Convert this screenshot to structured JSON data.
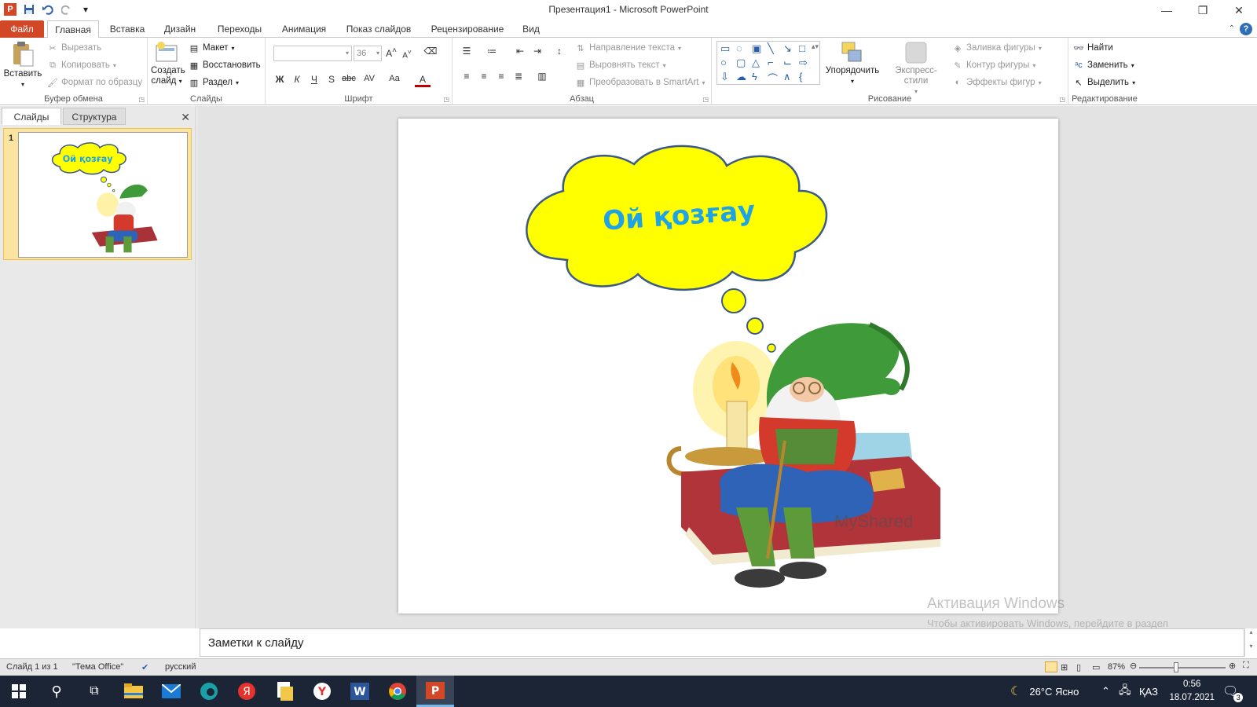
{
  "window": {
    "title": "Презентация1 - Microsoft PowerPoint"
  },
  "tabs": [
    "Файл",
    "Главная",
    "Вставка",
    "Дизайн",
    "Переходы",
    "Анимация",
    "Показ слайдов",
    "Рецензирование",
    "Вид"
  ],
  "ribbon": {
    "clipboard": {
      "label": "Буфер обмена",
      "paste": "Вставить",
      "cut": "Вырезать",
      "copy": "Копировать",
      "format_painter": "Формат по образцу"
    },
    "slides": {
      "label": "Слайды",
      "new_slide": "Создать слайд",
      "layout": "Макет",
      "reset": "Восстановить",
      "section": "Раздел"
    },
    "font": {
      "label": "Шрифт",
      "font_size": "36",
      "bold": "Ж",
      "italic": "К",
      "underline": "Ч",
      "shadow": "S",
      "strike": "abc",
      "spacing": "AV",
      "case": "Aa",
      "color": "A",
      "grow": "A",
      "shrink": "A"
    },
    "paragraph": {
      "label": "Абзац",
      "text_direction": "Направление текста",
      "align_text": "Выровнять текст",
      "smartart": "Преобразовать в SmartArt"
    },
    "drawing": {
      "label": "Рисование",
      "arrange": "Упорядочить",
      "quick_styles": "Экспресс-стили",
      "shape_fill": "Заливка фигуры",
      "shape_outline": "Контур фигуры",
      "shape_effects": "Эффекты фигур"
    },
    "editing": {
      "label": "Редактирование",
      "find": "Найти",
      "replace": "Заменить",
      "select": "Выделить"
    }
  },
  "left_panel": {
    "tabs": [
      "Слайды",
      "Структура"
    ],
    "slide_number": "1",
    "thumb_text": "Ой қозғау"
  },
  "slide": {
    "bubble_text": "Ой қозғау",
    "image_watermark": "MyShared"
  },
  "notes": {
    "placeholder": "Заметки к слайду"
  },
  "activation": {
    "title": "Активация Windows",
    "text": "Чтобы активировать Windows, перейдите в раздел\n\"Параметры\"."
  },
  "status_bar": {
    "slide_info": "Слайд 1 из 1",
    "theme": "\"Тема Office\"",
    "language": "русский",
    "zoom": "87%"
  },
  "taskbar": {
    "weather": "26°C  Ясно",
    "lang": "ҚАЗ",
    "time": "0:56",
    "date": "18.07.2021",
    "notifications": "3"
  },
  "colors": {
    "file_tab": "#d24726",
    "bubble_fill": "#ffff00",
    "bubble_stroke": "#3c5a86",
    "bubble_text": "#1ea3e6",
    "taskbar": "#1c2535"
  }
}
